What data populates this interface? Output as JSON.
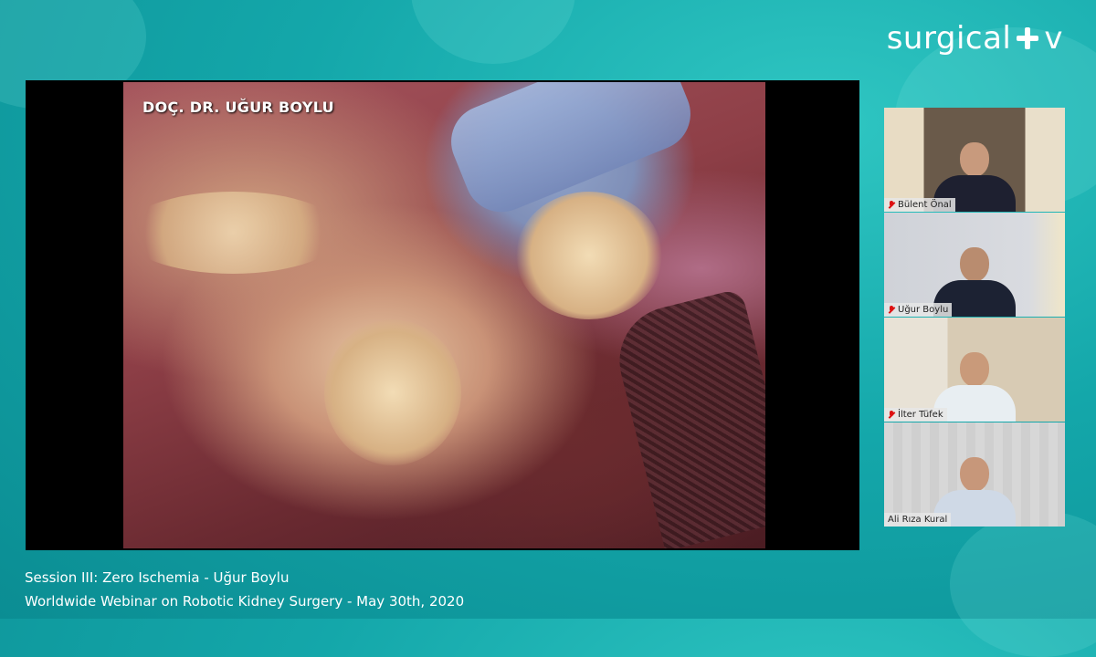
{
  "brand": {
    "name": "surgical",
    "suffix": "v"
  },
  "main_video": {
    "caption": "DOÇ. DR. UĞUR BOYLU"
  },
  "participants": [
    {
      "name": "Bülent Önal",
      "muted": true
    },
    {
      "name": "Uğur Boylu",
      "muted": true
    },
    {
      "name": "İlter Tüfek",
      "muted": true
    },
    {
      "name": "Ali Rıza Kural",
      "muted": false
    }
  ],
  "footer": {
    "session": "Session III: Zero Ischemia - Uğur Boylu",
    "event": "Worldwide Webinar on Robotic Kidney Surgery - May 30th, 2020"
  },
  "colors": {
    "background": "#14a7aa",
    "mute": "#dd1111"
  }
}
